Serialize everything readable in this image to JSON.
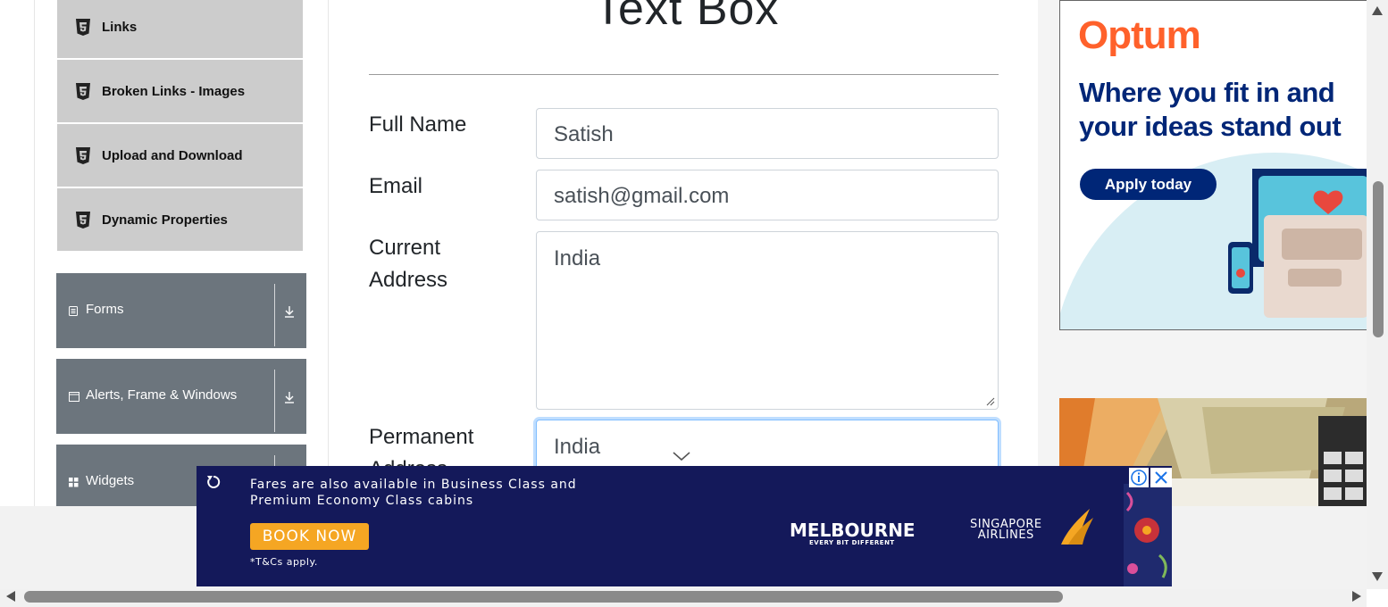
{
  "sidebar": {
    "items": [
      {
        "label": "Links",
        "icon": "html5-icon"
      },
      {
        "label": "Broken Links - Images",
        "icon": "html5-icon"
      },
      {
        "label": "Upload and Download",
        "icon": "html5-icon"
      },
      {
        "label": "Dynamic Properties",
        "icon": "html5-icon"
      }
    ],
    "groups": [
      {
        "label": "Forms",
        "icon": "document-icon"
      },
      {
        "label": "Alerts, Frame & Windows",
        "icon": "window-icon"
      },
      {
        "label": "Widgets",
        "icon": "widgets-icon"
      }
    ]
  },
  "main": {
    "title": "Text Box",
    "fields": {
      "full_name": {
        "label": "Full Name",
        "value": "Satish"
      },
      "email": {
        "label": "Email",
        "value": "satish@gmail.com"
      },
      "current_address": {
        "label_line1": "Current",
        "label_line2": "Address",
        "value": "India"
      },
      "permanent_address": {
        "label_line1": "Permanent",
        "label_line2": "Address",
        "value": "India"
      }
    }
  },
  "ads": {
    "optum": {
      "brand": "Optum",
      "headline": "Where you fit in and your ideas stand out",
      "cta": "Apply today",
      "brand_color": "#ff612b",
      "navy": "#002677"
    },
    "banner": {
      "line1": "Fares are also available in Business Class and",
      "line2": "Premium Economy Class cabins",
      "cta": "BOOK NOW",
      "terms": "*T&Cs apply.",
      "city": "MELBOURNE",
      "city_tagline": "EVERY BIT DIFFERENT",
      "airline_line1": "SINGAPORE",
      "airline_line2": "AIRLINES",
      "background": "#14195a",
      "cta_color": "#f5a623"
    }
  },
  "colors": {
    "sidebar_item": "#cccccc",
    "sidebar_group": "#6c757d",
    "focus_border": "#80bdff"
  }
}
